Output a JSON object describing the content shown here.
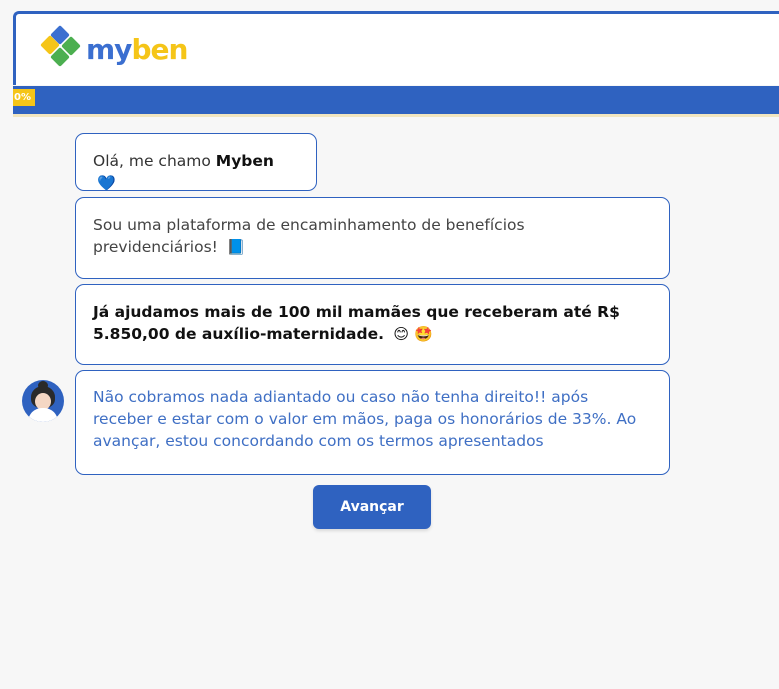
{
  "header": {
    "logo_text_part1": "my",
    "logo_text_part2": "ben",
    "logo_colors": [
      "#2f62c0",
      "#f5c518",
      "#4caf50",
      "#3b6fd0"
    ]
  },
  "progress": {
    "label": "0%",
    "value": 0
  },
  "chat": {
    "messages": [
      {
        "text": "Olá, me chamo ",
        "bold": "Myben",
        "emoji": "💙"
      },
      {
        "text": "Sou uma plataforma de encaminhamento de benefícios previdenciários!",
        "emoji": "📘"
      },
      {
        "text": "Já ajudamos mais de 100 mil mamães que receberam até R$ 5.850,00 de auxílio-maternidade.",
        "emoji": "😊 🤩"
      },
      {
        "text": "Não cobramos nada adiantado ou caso não tenha direito!! após receber e estar com o valor em mãos, paga os honorários de 33%. Ao avançar, estou concordando com os termos apresentados"
      }
    ]
  },
  "actions": {
    "advance_label": "Avançar"
  },
  "colors": {
    "primary": "#2f62c0",
    "accent": "#f5c518",
    "background": "#f7f7f7"
  }
}
